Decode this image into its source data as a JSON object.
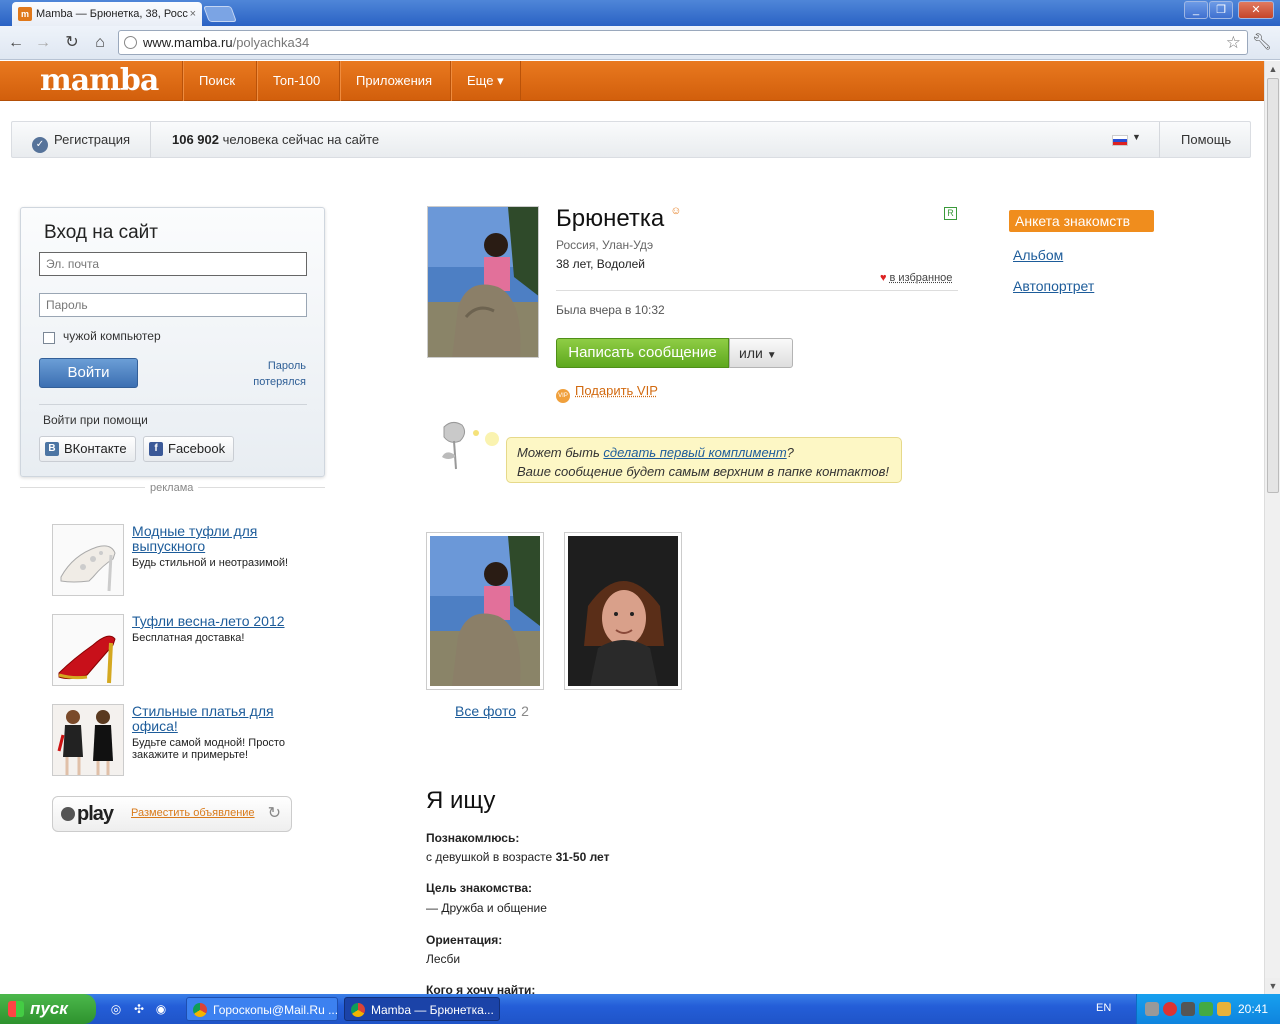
{
  "browser": {
    "tab_title": "Mamba — Брюнетка, 38, Росс",
    "tab_close": "×",
    "url_host": "www.mamba.ru",
    "url_path": "/polyachka34",
    "window_buttons": [
      "_",
      "❐",
      "✕"
    ]
  },
  "site": {
    "logo": "mamba",
    "nav": [
      "Поиск",
      "Топ-100",
      "Приложения",
      "Еще ▾"
    ],
    "register": "Регистрация",
    "online_count": "106 902",
    "online_text": "человека сейчас на сайте",
    "help": "Помощь"
  },
  "login": {
    "title": "Вход на сайт",
    "email_placeholder": "Эл. почта",
    "password_placeholder": "Пароль",
    "remember": "чужой компьютер",
    "submit": "Войти",
    "lost_line1": "Пароль",
    "lost_line2": "потерялся",
    "via": "Войти при помощи",
    "vk": "ВКонтакте",
    "facebook": "Facebook"
  },
  "ads": {
    "label": "реклама",
    "items": [
      {
        "title": "Модные туфли для выпускного",
        "desc": "Будь стильной и неотразимой!"
      },
      {
        "title": "Туфли весна-лето 2012",
        "desc": "Бесплатная доставка!"
      },
      {
        "title": "Стильные платья для офиса!",
        "desc": "Будьте самой модной! Просто закажите и примерьте!"
      }
    ],
    "play_logo": "play",
    "play_link": "Разместить объявление"
  },
  "profile": {
    "name": "Брюнетка",
    "location": "Россия, Улан-Удэ",
    "age": "38 лет, Водолей",
    "r_badge": "R",
    "favorite": "в избранное",
    "last_seen": "Была вчера в 10:32",
    "write_message": "Написать сообщение",
    "or": "или",
    "gift_vip": "Подарить VIP",
    "vip_icon_text": "VIP",
    "compliment_prefix": "Может быть ",
    "compliment_link": "сделать первый комплимент",
    "compliment_suffix": "?",
    "compliment_line2": "Ваше сообщение будет самым верхним в папке контактов!",
    "all_photos": "Все фото",
    "photo_count": "2"
  },
  "seeking": {
    "title": "Я ищу",
    "items": [
      {
        "label": "Познакомлюсь:",
        "value_prefix": "с девушкой в возрасте ",
        "value_bold": "31-50 лет"
      },
      {
        "label": "Цель знакомства:",
        "value": "— Дружба и общение"
      },
      {
        "label": "Ориентация:",
        "value": "Лесби"
      },
      {
        "label": "Кого я хочу найти:",
        "value": ""
      }
    ]
  },
  "right_nav": {
    "active": "Анкета знакомств",
    "links": [
      "Альбом",
      "Автопортрет"
    ]
  },
  "taskbar": {
    "start": "пуск",
    "tasks": [
      "Гороскопы@Mail.Ru ...",
      "Mamba — Брюнетка..."
    ],
    "lang": "EN",
    "time": "20:41"
  },
  "colors": {
    "brand_orange": "#e0701a",
    "link_blue": "#1d5c9a",
    "green_button": "#6bb52a"
  }
}
